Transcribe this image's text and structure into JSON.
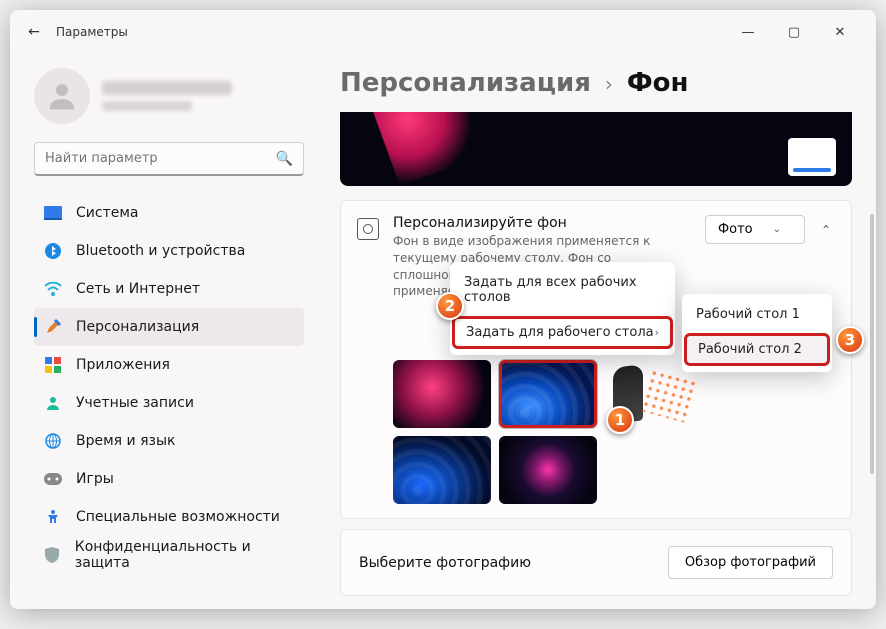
{
  "window": {
    "title": "Параметры"
  },
  "search": {
    "placeholder": "Найти параметр"
  },
  "nav": {
    "items": [
      {
        "label": "Система"
      },
      {
        "label": "Bluetooth и устройства"
      },
      {
        "label": "Сеть и Интернет"
      },
      {
        "label": "Персонализация"
      },
      {
        "label": "Приложения"
      },
      {
        "label": "Учетные записи"
      },
      {
        "label": "Время и язык"
      },
      {
        "label": "Игры"
      },
      {
        "label": "Специальные возможности"
      },
      {
        "label": "Конфиденциальность и защита"
      }
    ]
  },
  "breadcrumb": {
    "parent": "Персонализация",
    "sep": "›",
    "current": "Фон"
  },
  "bgcard": {
    "title": "Персонализируйте фон",
    "desc": "Фон в виде изображения применяется к текущему рабочему столу. Фон со сплошной заливкой или в виде слайд-шоу применяется ко всем рабочим столам.",
    "dropdown": "Фото"
  },
  "context": {
    "all": "Задать для всех рабочих столов",
    "one": "Задать для рабочего стола"
  },
  "submenu": {
    "d1": "Рабочий стол 1",
    "d2": "Рабочий стол 2"
  },
  "choose": {
    "title": "Выберите фотографию",
    "browse": "Обзор фотографий"
  },
  "callouts": {
    "c1": "1",
    "c2": "2",
    "c3": "3"
  }
}
